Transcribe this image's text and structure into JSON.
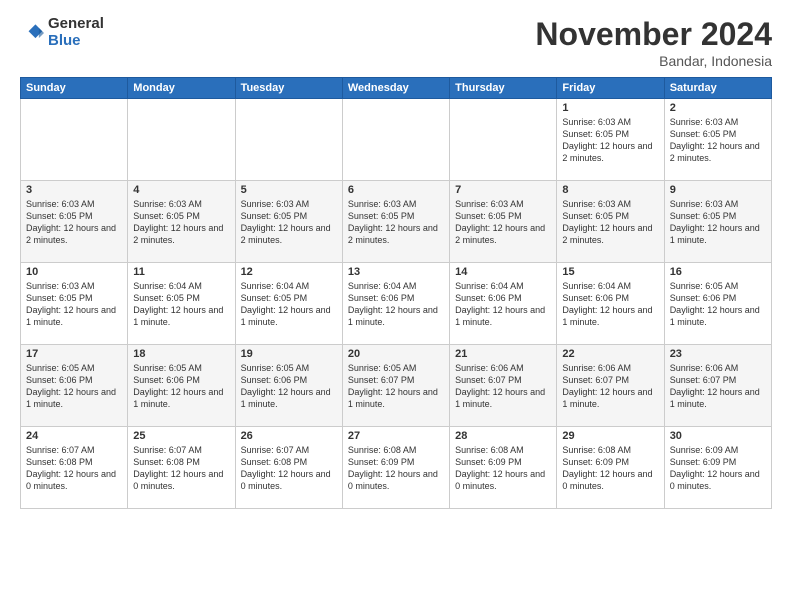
{
  "logo": {
    "general": "General",
    "blue": "Blue"
  },
  "header": {
    "month": "November 2024",
    "location": "Bandar, Indonesia"
  },
  "days_of_week": [
    "Sunday",
    "Monday",
    "Tuesday",
    "Wednesday",
    "Thursday",
    "Friday",
    "Saturday"
  ],
  "weeks": [
    [
      {
        "day": "",
        "info": ""
      },
      {
        "day": "",
        "info": ""
      },
      {
        "day": "",
        "info": ""
      },
      {
        "day": "",
        "info": ""
      },
      {
        "day": "",
        "info": ""
      },
      {
        "day": "1",
        "info": "Sunrise: 6:03 AM\nSunset: 6:05 PM\nDaylight: 12 hours and 2 minutes."
      },
      {
        "day": "2",
        "info": "Sunrise: 6:03 AM\nSunset: 6:05 PM\nDaylight: 12 hours and 2 minutes."
      }
    ],
    [
      {
        "day": "3",
        "info": "Sunrise: 6:03 AM\nSunset: 6:05 PM\nDaylight: 12 hours and 2 minutes."
      },
      {
        "day": "4",
        "info": "Sunrise: 6:03 AM\nSunset: 6:05 PM\nDaylight: 12 hours and 2 minutes."
      },
      {
        "day": "5",
        "info": "Sunrise: 6:03 AM\nSunset: 6:05 PM\nDaylight: 12 hours and 2 minutes."
      },
      {
        "day": "6",
        "info": "Sunrise: 6:03 AM\nSunset: 6:05 PM\nDaylight: 12 hours and 2 minutes."
      },
      {
        "day": "7",
        "info": "Sunrise: 6:03 AM\nSunset: 6:05 PM\nDaylight: 12 hours and 2 minutes."
      },
      {
        "day": "8",
        "info": "Sunrise: 6:03 AM\nSunset: 6:05 PM\nDaylight: 12 hours and 2 minutes."
      },
      {
        "day": "9",
        "info": "Sunrise: 6:03 AM\nSunset: 6:05 PM\nDaylight: 12 hours and 1 minute."
      }
    ],
    [
      {
        "day": "10",
        "info": "Sunrise: 6:03 AM\nSunset: 6:05 PM\nDaylight: 12 hours and 1 minute."
      },
      {
        "day": "11",
        "info": "Sunrise: 6:04 AM\nSunset: 6:05 PM\nDaylight: 12 hours and 1 minute."
      },
      {
        "day": "12",
        "info": "Sunrise: 6:04 AM\nSunset: 6:05 PM\nDaylight: 12 hours and 1 minute."
      },
      {
        "day": "13",
        "info": "Sunrise: 6:04 AM\nSunset: 6:06 PM\nDaylight: 12 hours and 1 minute."
      },
      {
        "day": "14",
        "info": "Sunrise: 6:04 AM\nSunset: 6:06 PM\nDaylight: 12 hours and 1 minute."
      },
      {
        "day": "15",
        "info": "Sunrise: 6:04 AM\nSunset: 6:06 PM\nDaylight: 12 hours and 1 minute."
      },
      {
        "day": "16",
        "info": "Sunrise: 6:05 AM\nSunset: 6:06 PM\nDaylight: 12 hours and 1 minute."
      }
    ],
    [
      {
        "day": "17",
        "info": "Sunrise: 6:05 AM\nSunset: 6:06 PM\nDaylight: 12 hours and 1 minute."
      },
      {
        "day": "18",
        "info": "Sunrise: 6:05 AM\nSunset: 6:06 PM\nDaylight: 12 hours and 1 minute."
      },
      {
        "day": "19",
        "info": "Sunrise: 6:05 AM\nSunset: 6:06 PM\nDaylight: 12 hours and 1 minute."
      },
      {
        "day": "20",
        "info": "Sunrise: 6:05 AM\nSunset: 6:07 PM\nDaylight: 12 hours and 1 minute."
      },
      {
        "day": "21",
        "info": "Sunrise: 6:06 AM\nSunset: 6:07 PM\nDaylight: 12 hours and 1 minute."
      },
      {
        "day": "22",
        "info": "Sunrise: 6:06 AM\nSunset: 6:07 PM\nDaylight: 12 hours and 1 minute."
      },
      {
        "day": "23",
        "info": "Sunrise: 6:06 AM\nSunset: 6:07 PM\nDaylight: 12 hours and 1 minute."
      }
    ],
    [
      {
        "day": "24",
        "info": "Sunrise: 6:07 AM\nSunset: 6:08 PM\nDaylight: 12 hours and 0 minutes."
      },
      {
        "day": "25",
        "info": "Sunrise: 6:07 AM\nSunset: 6:08 PM\nDaylight: 12 hours and 0 minutes."
      },
      {
        "day": "26",
        "info": "Sunrise: 6:07 AM\nSunset: 6:08 PM\nDaylight: 12 hours and 0 minutes."
      },
      {
        "day": "27",
        "info": "Sunrise: 6:08 AM\nSunset: 6:09 PM\nDaylight: 12 hours and 0 minutes."
      },
      {
        "day": "28",
        "info": "Sunrise: 6:08 AM\nSunset: 6:09 PM\nDaylight: 12 hours and 0 minutes."
      },
      {
        "day": "29",
        "info": "Sunrise: 6:08 AM\nSunset: 6:09 PM\nDaylight: 12 hours and 0 minutes."
      },
      {
        "day": "30",
        "info": "Sunrise: 6:09 AM\nSunset: 6:09 PM\nDaylight: 12 hours and 0 minutes."
      }
    ]
  ]
}
